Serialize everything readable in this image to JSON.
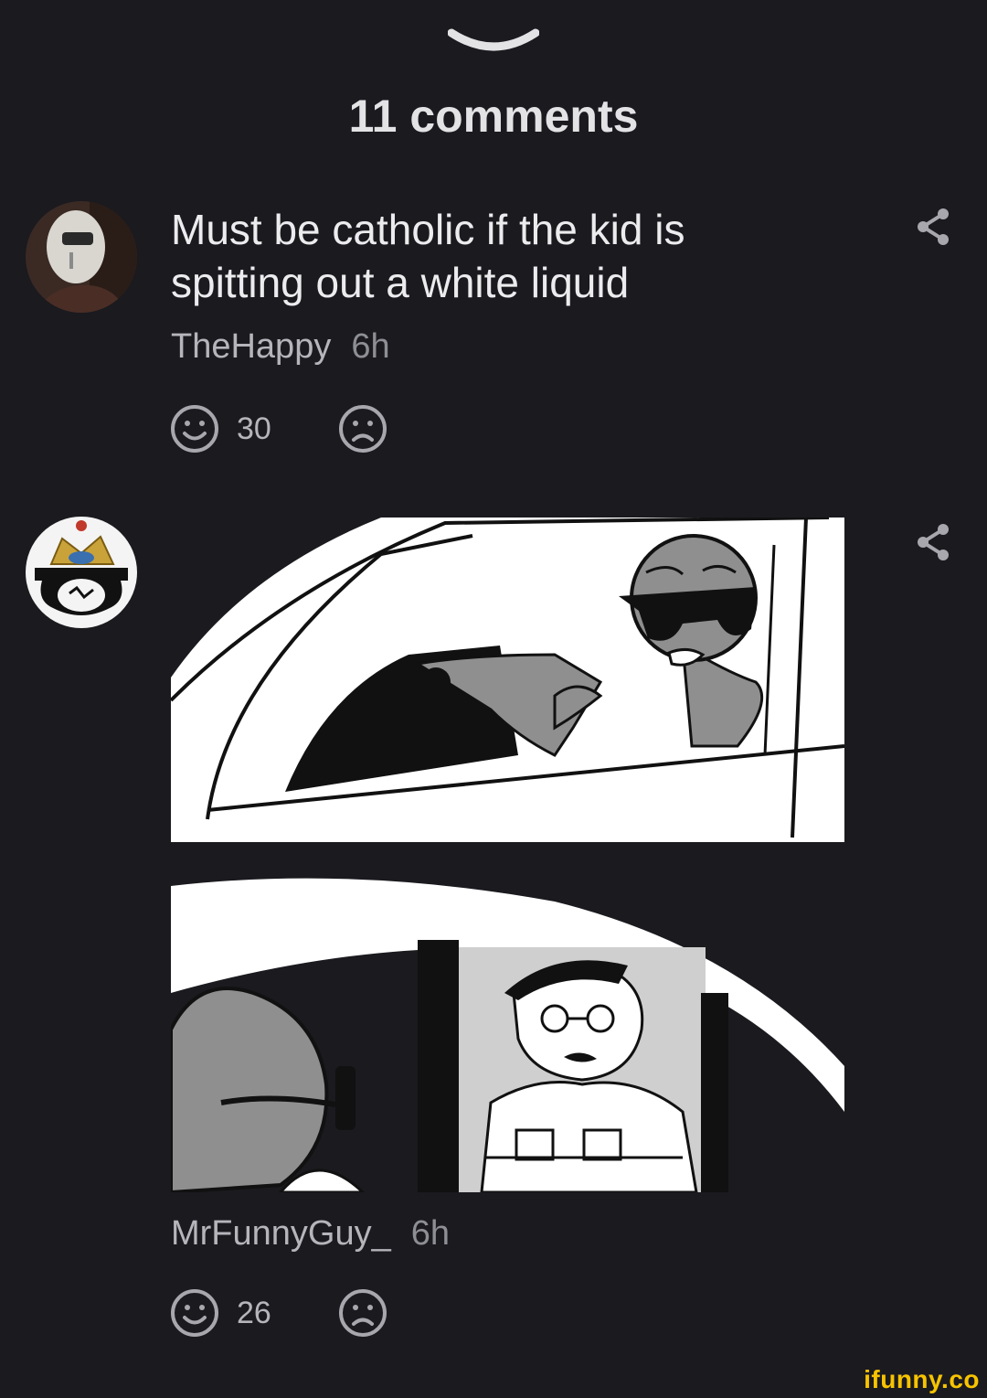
{
  "header": {
    "comments_title": "11 comments"
  },
  "comments": [
    {
      "text": "Must be catholic if the kid is spitting out a white liquid",
      "author": "TheHappy",
      "time": "6h",
      "smile_count": "30"
    },
    {
      "author": "MrFunnyGuy_",
      "time": "6h",
      "smile_count": "26"
    }
  ],
  "watermark": "ifunny.co",
  "colors": {
    "background": "#1a1a1f",
    "text": "#ececee",
    "muted": "#8e8e95",
    "icon": "#a7a7ad",
    "watermark": "#f7c300"
  },
  "icons": [
    "chevron-down-icon",
    "share-icon",
    "smile-icon",
    "frown-icon"
  ]
}
